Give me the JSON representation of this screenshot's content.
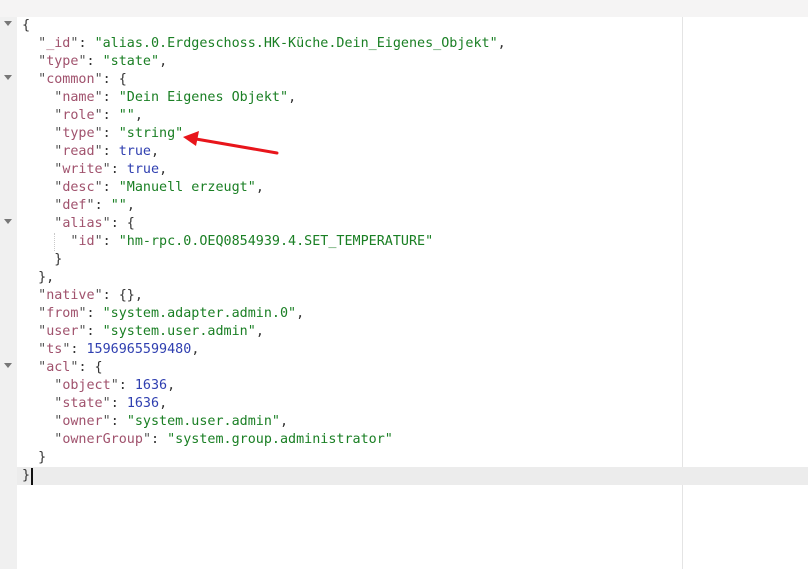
{
  "editor": {
    "lines": [
      {
        "indent": 0,
        "tokens": [
          {
            "t": "p",
            "v": "{"
          }
        ]
      },
      {
        "indent": 1,
        "tokens": [
          {
            "t": "k",
            "v": "_id"
          },
          {
            "t": "p",
            "v": ": "
          },
          {
            "t": "s",
            "v": "\"alias.0.Erdgeschoss.HK-Küche.Dein_Eigenes_Objekt\""
          },
          {
            "t": "p",
            "v": ","
          }
        ]
      },
      {
        "indent": 1,
        "tokens": [
          {
            "t": "k",
            "v": "type"
          },
          {
            "t": "p",
            "v": ": "
          },
          {
            "t": "s",
            "v": "\"state\""
          },
          {
            "t": "p",
            "v": ","
          }
        ]
      },
      {
        "indent": 1,
        "tokens": [
          {
            "t": "k",
            "v": "common"
          },
          {
            "t": "p",
            "v": ": {"
          }
        ]
      },
      {
        "indent": 2,
        "tokens": [
          {
            "t": "k",
            "v": "name"
          },
          {
            "t": "p",
            "v": ": "
          },
          {
            "t": "s",
            "v": "\"Dein Eigenes Objekt\""
          },
          {
            "t": "p",
            "v": ","
          }
        ]
      },
      {
        "indent": 2,
        "tokens": [
          {
            "t": "k",
            "v": "role"
          },
          {
            "t": "p",
            "v": ": "
          },
          {
            "t": "s",
            "v": "\"\""
          },
          {
            "t": "p",
            "v": ","
          }
        ]
      },
      {
        "indent": 2,
        "tokens": [
          {
            "t": "k",
            "v": "type"
          },
          {
            "t": "p",
            "v": ": "
          },
          {
            "t": "s",
            "v": "\"string\""
          }
        ]
      },
      {
        "indent": 2,
        "tokens": [
          {
            "t": "k",
            "v": "read"
          },
          {
            "t": "p",
            "v": ": "
          },
          {
            "t": "b",
            "v": "true"
          },
          {
            "t": "p",
            "v": ","
          }
        ]
      },
      {
        "indent": 2,
        "tokens": [
          {
            "t": "k",
            "v": "write"
          },
          {
            "t": "p",
            "v": ": "
          },
          {
            "t": "b",
            "v": "true"
          },
          {
            "t": "p",
            "v": ","
          }
        ]
      },
      {
        "indent": 2,
        "tokens": [
          {
            "t": "k",
            "v": "desc"
          },
          {
            "t": "p",
            "v": ": "
          },
          {
            "t": "s",
            "v": "\"Manuell erzeugt\""
          },
          {
            "t": "p",
            "v": ","
          }
        ]
      },
      {
        "indent": 2,
        "tokens": [
          {
            "t": "k",
            "v": "def"
          },
          {
            "t": "p",
            "v": ": "
          },
          {
            "t": "s",
            "v": "\"\""
          },
          {
            "t": "p",
            "v": ","
          }
        ]
      },
      {
        "indent": 2,
        "tokens": [
          {
            "t": "k",
            "v": "alias"
          },
          {
            "t": "p",
            "v": ": {"
          }
        ]
      },
      {
        "indent": 3,
        "tokens": [
          {
            "t": "k",
            "v": "id"
          },
          {
            "t": "p",
            "v": ": "
          },
          {
            "t": "s",
            "v": "\"hm-rpc.0.OEQ0854939.4.SET_TEMPERATURE\""
          }
        ]
      },
      {
        "indent": 2,
        "tokens": [
          {
            "t": "p",
            "v": "}"
          }
        ]
      },
      {
        "indent": 1,
        "tokens": [
          {
            "t": "p",
            "v": "},"
          }
        ]
      },
      {
        "indent": 1,
        "tokens": [
          {
            "t": "k",
            "v": "native"
          },
          {
            "t": "p",
            "v": ": {},"
          }
        ]
      },
      {
        "indent": 1,
        "tokens": [
          {
            "t": "k",
            "v": "from"
          },
          {
            "t": "p",
            "v": ": "
          },
          {
            "t": "s",
            "v": "\"system.adapter.admin.0\""
          },
          {
            "t": "p",
            "v": ","
          }
        ]
      },
      {
        "indent": 1,
        "tokens": [
          {
            "t": "k",
            "v": "user"
          },
          {
            "t": "p",
            "v": ": "
          },
          {
            "t": "s",
            "v": "\"system.user.admin\""
          },
          {
            "t": "p",
            "v": ","
          }
        ]
      },
      {
        "indent": 1,
        "tokens": [
          {
            "t": "k",
            "v": "ts"
          },
          {
            "t": "p",
            "v": ": "
          },
          {
            "t": "n",
            "v": "1596965599480"
          },
          {
            "t": "p",
            "v": ","
          }
        ]
      },
      {
        "indent": 1,
        "tokens": [
          {
            "t": "k",
            "v": "acl"
          },
          {
            "t": "p",
            "v": ": {"
          }
        ]
      },
      {
        "indent": 2,
        "tokens": [
          {
            "t": "k",
            "v": "object"
          },
          {
            "t": "p",
            "v": ": "
          },
          {
            "t": "n",
            "v": "1636"
          },
          {
            "t": "p",
            "v": ","
          }
        ]
      },
      {
        "indent": 2,
        "tokens": [
          {
            "t": "k",
            "v": "state"
          },
          {
            "t": "p",
            "v": ": "
          },
          {
            "t": "n",
            "v": "1636"
          },
          {
            "t": "p",
            "v": ","
          }
        ]
      },
      {
        "indent": 2,
        "tokens": [
          {
            "t": "k",
            "v": "owner"
          },
          {
            "t": "p",
            "v": ": "
          },
          {
            "t": "s",
            "v": "\"system.user.admin\""
          },
          {
            "t": "p",
            "v": ","
          }
        ]
      },
      {
        "indent": 2,
        "tokens": [
          {
            "t": "k",
            "v": "ownerGroup"
          },
          {
            "t": "p",
            "v": ": "
          },
          {
            "t": "s",
            "v": "\"system.group.administrator\""
          }
        ]
      },
      {
        "indent": 1,
        "tokens": [
          {
            "t": "p",
            "v": "}"
          }
        ]
      },
      {
        "indent": 0,
        "tokens": [
          {
            "t": "p",
            "v": "}"
          }
        ]
      }
    ],
    "fold_markers": [
      "fold-arrow-icon",
      "fold-arrow-icon",
      "fold-arrow-icon",
      "fold-arrow-icon"
    ],
    "annotation": {
      "icon": "red-arrow-icon",
      "color": "#e8151b"
    }
  },
  "colors": {
    "key": "#a0526d",
    "string": "#1a7f24",
    "number": "#2f3fb0",
    "literal": "#2f3fb0"
  }
}
